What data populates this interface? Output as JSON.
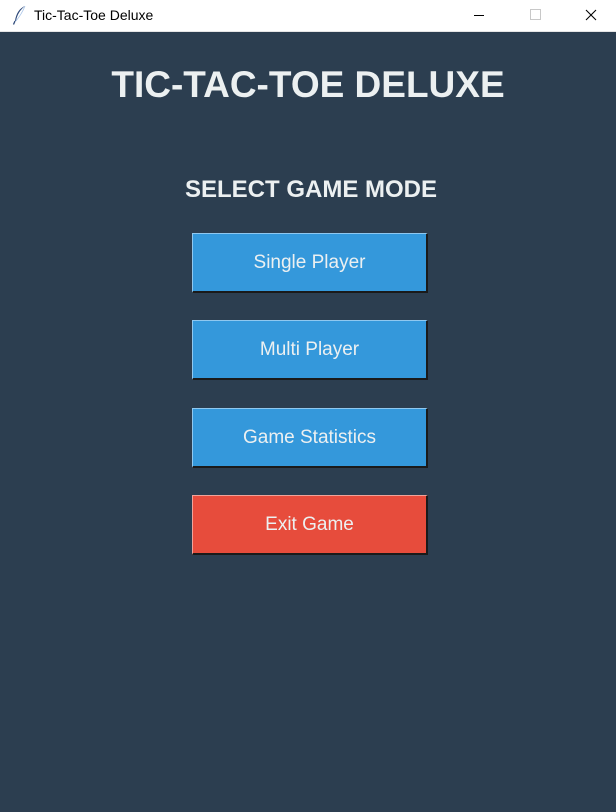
{
  "window": {
    "title": "Tic-Tac-Toe Deluxe",
    "controls": [
      "minimize",
      "maximize",
      "close"
    ]
  },
  "app": {
    "heading": "TIC-TAC-TOE DELUXE",
    "subheading": "SELECT GAME MODE",
    "buttons": [
      {
        "label": "Single Player",
        "color": "#3498db"
      },
      {
        "label": "Multi Player",
        "color": "#3498db"
      },
      {
        "label": "Game Statistics",
        "color": "#3498db"
      },
      {
        "label": "Exit Game",
        "color": "#e74c3c"
      }
    ]
  },
  "colors": {
    "background": "#2c3e50",
    "text": "#ecf0f1"
  },
  "icons": {
    "app": "feather-icon",
    "minimize": "minimize-icon",
    "maximize": "maximize-icon",
    "close": "close-icon"
  }
}
